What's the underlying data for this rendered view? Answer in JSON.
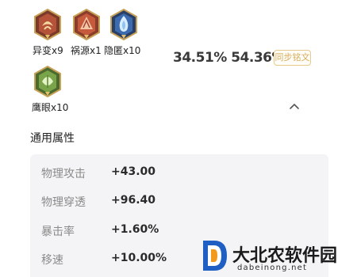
{
  "emblems": [
    {
      "name": "fire-emblem-icon",
      "label": "异变x9",
      "color": "#b5523a"
    },
    {
      "name": "shatter-emblem-icon",
      "label": "祸源x1",
      "color": "#c65a3d"
    },
    {
      "name": "blue-flame-emblem-icon",
      "label": "隐匿x10",
      "color": "#3c6bb0"
    },
    {
      "name": "leaf-emblem-icon",
      "label": "鹰眼x10",
      "color": "#7aa44a"
    }
  ],
  "stats": {
    "rates": "34.51% 54.36%"
  },
  "sync_button": {
    "label": "同步铭文",
    "color": "#d8ad5e"
  },
  "section": {
    "title": "通用属性"
  },
  "attributes": [
    {
      "name": "物理攻击",
      "value": "+43.00"
    },
    {
      "name": "物理穿透",
      "value": "+96.40"
    },
    {
      "name": "暴击率",
      "value": "+1.60%"
    },
    {
      "name": "移速",
      "value": "+10.00%"
    }
  ],
  "watermark": {
    "title": "大北农软件园",
    "url": "dabeinong.net"
  }
}
